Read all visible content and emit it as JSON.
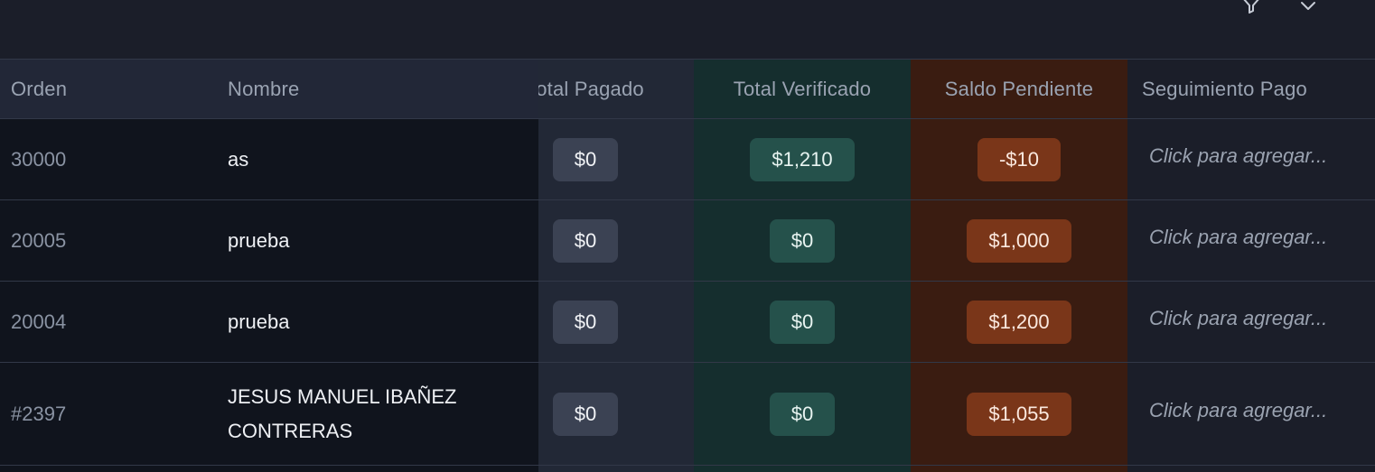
{
  "toolbar": {
    "icons": [
      "filter-icon",
      "chevron-down-icon"
    ]
  },
  "table": {
    "columns": {
      "orden": "Orden",
      "nombre": "Nombre",
      "total_pagado": "Total Pagado",
      "total_verificado": "Total Verificado",
      "saldo_pendiente": "Saldo Pendiente",
      "seguimiento_pago": "Seguimiento Pago"
    },
    "rows": [
      {
        "orden": "30000",
        "nombre": "as",
        "total_pagado": "$0",
        "total_verificado": "$1,210",
        "saldo_pendiente": "-$10",
        "seguimiento": "Click para agregar..."
      },
      {
        "orden": "20005",
        "nombre": "prueba",
        "total_pagado": "$0",
        "total_verificado": "$0",
        "saldo_pendiente": "$1,000",
        "seguimiento": "Click para agregar..."
      },
      {
        "orden": "20004",
        "nombre": "prueba",
        "total_pagado": "$0",
        "total_verificado": "$0",
        "saldo_pendiente": "$1,200",
        "seguimiento": "Click para agregar..."
      },
      {
        "orden": "#2397",
        "nombre": "JESUS MANUEL IBAÑEZ CONTRERAS",
        "total_pagado": "$0",
        "total_verificado": "$0",
        "saldo_pendiente": "$1,055",
        "seguimiento": "Click para agregar..."
      }
    ]
  },
  "colors": {
    "background": "#1b1e29",
    "verificado_column": "#152e2e",
    "pendiente_column": "#3a1c11",
    "pagado_column": "#222836",
    "pill_gray": "#3b4253",
    "pill_green": "#25514b",
    "pill_orange": "#7a3619"
  }
}
